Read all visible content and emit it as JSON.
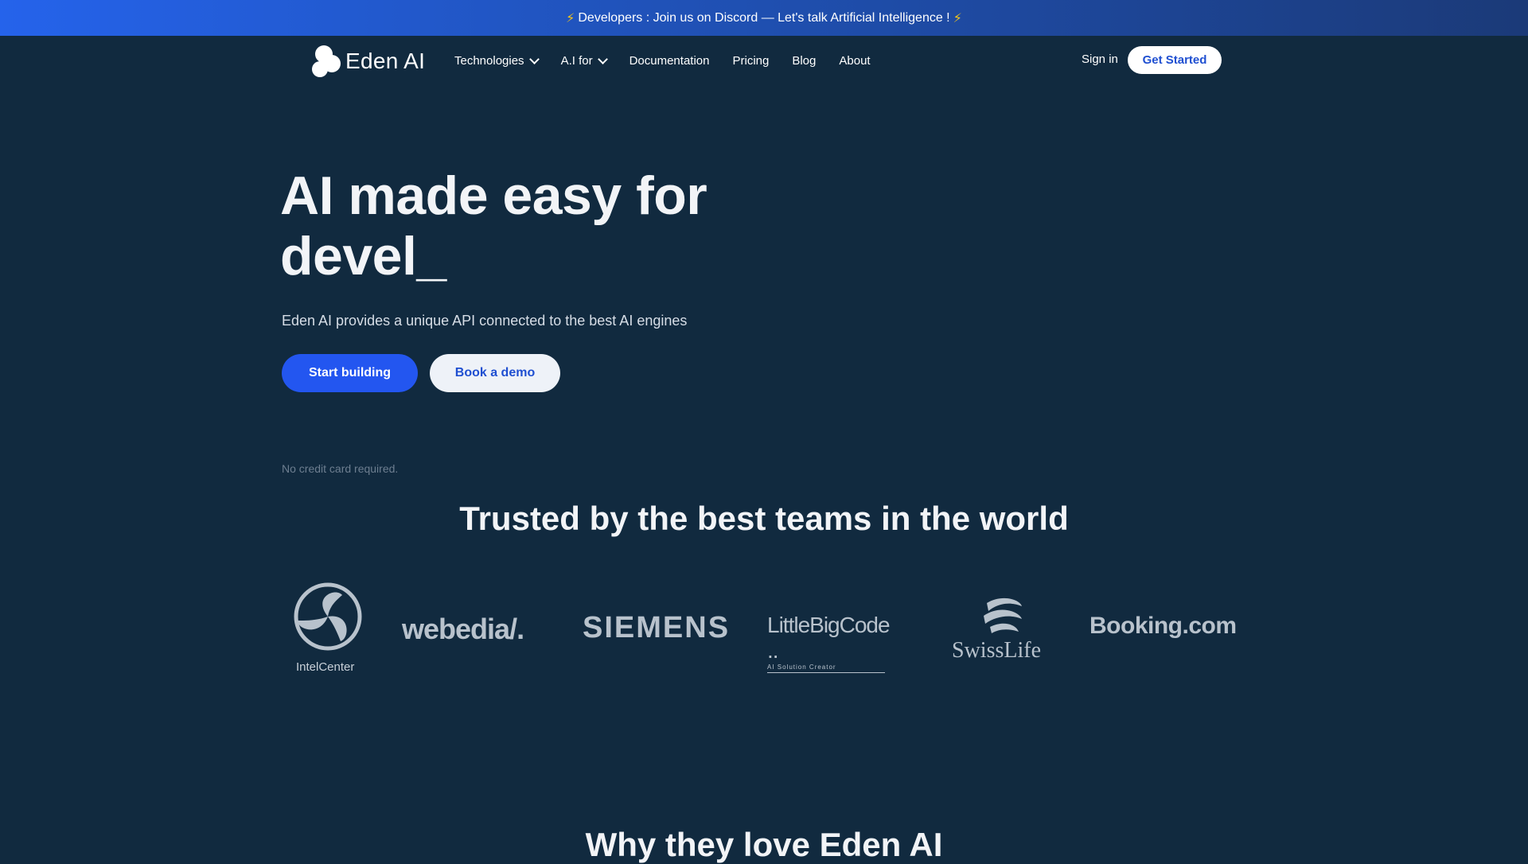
{
  "announcement": {
    "bolt": "⚡",
    "text": "Developers : Join us on Discord — Let's talk Artificial Intelligence !"
  },
  "nav": {
    "logo_text": "Eden AI",
    "items": [
      {
        "label": "Technologies",
        "dropdown": true
      },
      {
        "label": "A.I for",
        "dropdown": true
      },
      {
        "label": "Documentation",
        "dropdown": false
      },
      {
        "label": "Pricing",
        "dropdown": false
      },
      {
        "label": "Blog",
        "dropdown": false
      },
      {
        "label": "About",
        "dropdown": false
      }
    ],
    "signin": "Sign in",
    "get_started": "Get Started"
  },
  "hero": {
    "title_line1": "AI made easy for",
    "title_line2": "devel_",
    "subtitle": "Eden AI provides a unique API connected to the best AI engines",
    "primary_cta": "Start building",
    "secondary_cta": "Book a demo",
    "note": "No credit card required."
  },
  "trusted": {
    "heading": "Trusted by the best teams in the world",
    "logos": {
      "intelcenter": "IntelCenter",
      "webedia": "webedia",
      "siemens": "SIEMENS",
      "littlebigcode": "LittleBigCode",
      "littlebigcode_tagline": "AI Solution Creator",
      "swisslife": "SwissLife",
      "booking": "Booking.com"
    }
  },
  "why": {
    "heading": "Why they love Eden AI"
  },
  "colors": {
    "background": "#112a3f",
    "accent": "#2356f0",
    "announce_start": "#2563eb"
  }
}
